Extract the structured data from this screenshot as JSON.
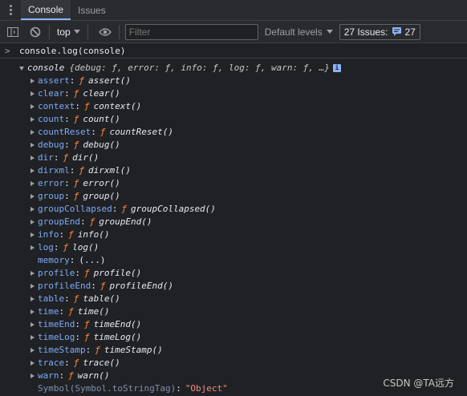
{
  "tabs": [
    {
      "label": "Console",
      "active": true
    },
    {
      "label": "Issues",
      "active": false
    }
  ],
  "toolbar": {
    "context": "top",
    "filter_placeholder": "Filter",
    "levels_label": "Default levels",
    "issues_label": "27 Issues:",
    "issues_count": "27"
  },
  "console": {
    "command": "console.log(console)",
    "object_name": "console",
    "object_preview": "{debug: ƒ, error: ƒ, info: ƒ, log: ƒ, warn: ƒ, …}",
    "info_badge": "i",
    "function_symbol": "ƒ",
    "properties": [
      {
        "key": "assert",
        "func": "assert()"
      },
      {
        "key": "clear",
        "func": "clear()"
      },
      {
        "key": "context",
        "func": "context()"
      },
      {
        "key": "count",
        "func": "count()"
      },
      {
        "key": "countReset",
        "func": "countReset()"
      },
      {
        "key": "debug",
        "func": "debug()"
      },
      {
        "key": "dir",
        "func": "dir()"
      },
      {
        "key": "dirxml",
        "func": "dirxml()"
      },
      {
        "key": "error",
        "func": "error()"
      },
      {
        "key": "group",
        "func": "group()"
      },
      {
        "key": "groupCollapsed",
        "func": "groupCollapsed()"
      },
      {
        "key": "groupEnd",
        "func": "groupEnd()"
      },
      {
        "key": "info",
        "func": "info()"
      },
      {
        "key": "log",
        "func": "log()"
      }
    ],
    "memory": {
      "key": "memory",
      "value": "(...)"
    },
    "properties2": [
      {
        "key": "profile",
        "func": "profile()"
      },
      {
        "key": "profileEnd",
        "func": "profileEnd()"
      },
      {
        "key": "table",
        "func": "table()"
      },
      {
        "key": "time",
        "func": "time()"
      },
      {
        "key": "timeEnd",
        "func": "timeEnd()"
      },
      {
        "key": "timeLog",
        "func": "timeLog()"
      },
      {
        "key": "timeStamp",
        "func": "timeStamp()"
      },
      {
        "key": "trace",
        "func": "trace()"
      },
      {
        "key": "warn",
        "func": "warn()"
      }
    ],
    "symbol": {
      "key": "Symbol(Symbol.toStringTag)",
      "value": "\"Object\""
    }
  },
  "watermark": "CSDN @TA远方",
  "colors": {
    "accent": "#8ab4f8",
    "key": "#7cacf8",
    "function_symbol": "#ff8a3c",
    "string": "#f28b82"
  }
}
